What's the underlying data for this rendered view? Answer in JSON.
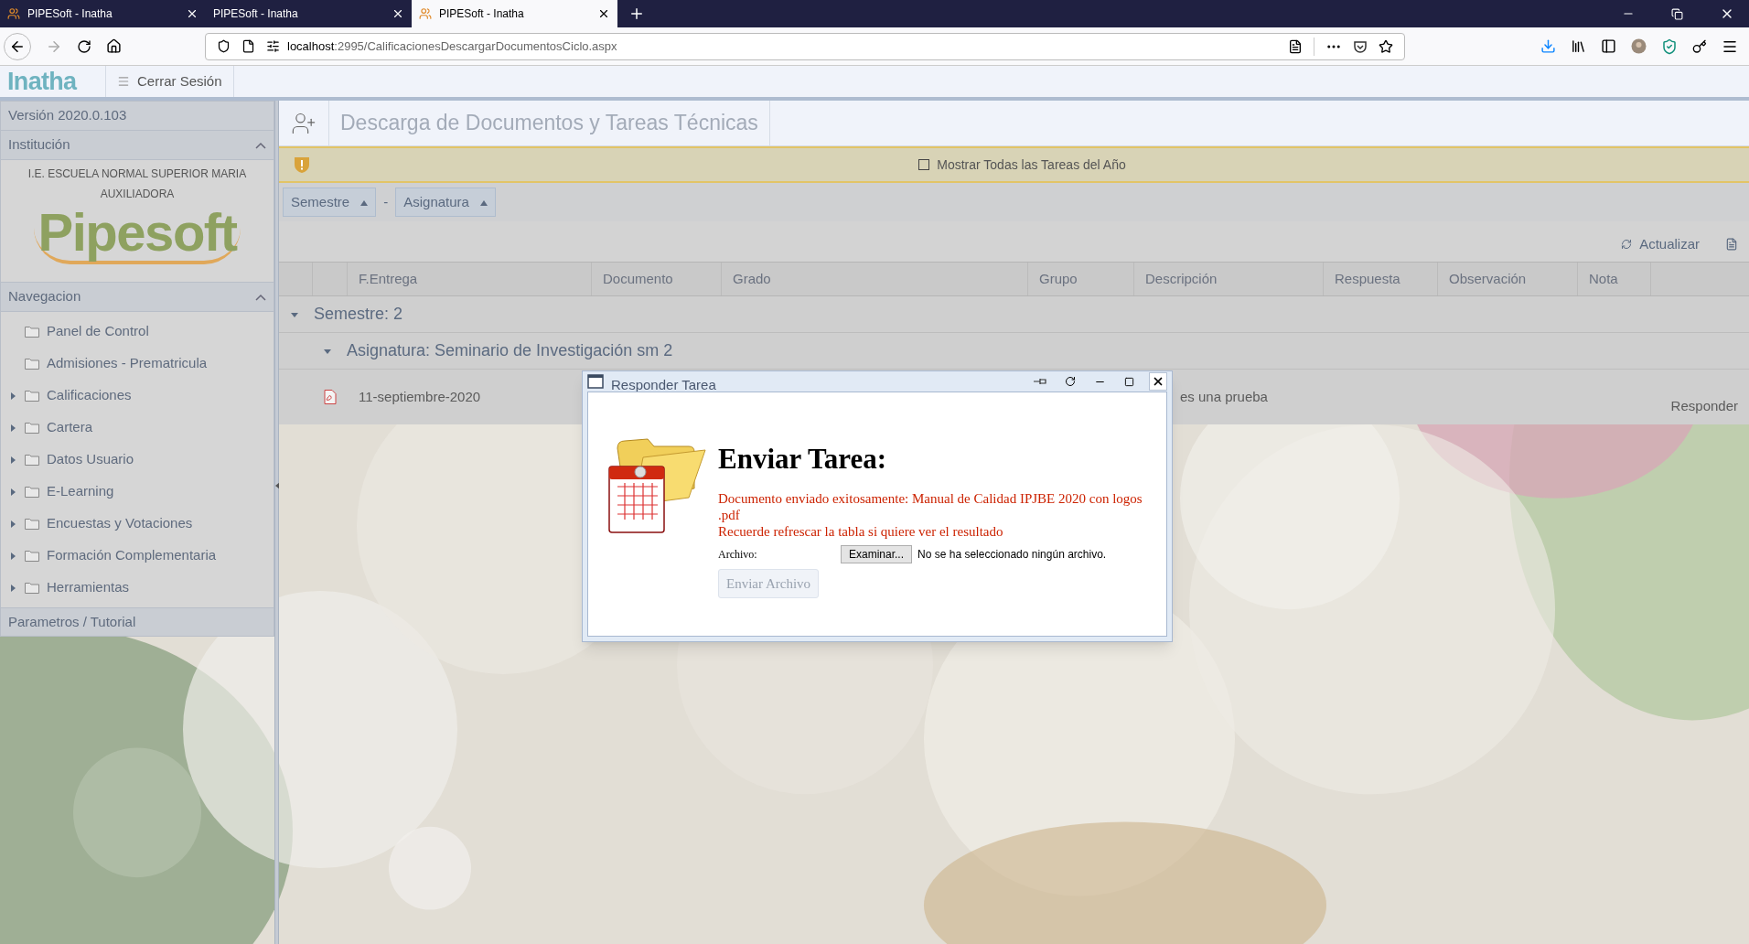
{
  "browser": {
    "tabs": [
      {
        "title": "PIPESoft - Inatha",
        "selected": false,
        "has_icon": true
      },
      {
        "title": "PIPESoft - Inatha",
        "selected": false,
        "has_icon": false
      },
      {
        "title": "PIPESoft - Inatha",
        "selected": true,
        "has_icon": true
      }
    ],
    "url": {
      "host": "localhost",
      "path": ":2995/CalificacionesDescargarDocumentosCiclo.aspx"
    }
  },
  "app_header": {
    "logo": "Inatha",
    "logout": "Cerrar Sesión"
  },
  "sidebar": {
    "version": "Versión 2020.0.103",
    "institution": {
      "title": "Institución",
      "expanded": true,
      "name": "I.E. ESCUELA NORMAL SUPERIOR MARIA AUXILIADORA",
      "logo": "Pipesoft"
    },
    "navigation": {
      "title": "Navegacion",
      "expanded": true,
      "items": [
        {
          "label": "Panel de Control",
          "has_children": false
        },
        {
          "label": "Admisiones - Prematricula",
          "has_children": false
        },
        {
          "label": "Calificaciones",
          "has_children": true
        },
        {
          "label": "Cartera",
          "has_children": true
        },
        {
          "label": "Datos Usuario",
          "has_children": true
        },
        {
          "label": "E-Learning",
          "has_children": true
        },
        {
          "label": "Encuestas y Votaciones",
          "has_children": true
        },
        {
          "label": "Formación Complementaria",
          "has_children": true
        },
        {
          "label": "Herramientas",
          "has_children": true
        }
      ]
    },
    "footer": "Parametros / Tutorial"
  },
  "main": {
    "title": "Descarga de Documentos y Tareas Técnicas",
    "notice": {
      "label": "Mostrar Todas las Tareas del Año",
      "checked": false
    },
    "group_chips": [
      "Semestre",
      "Asignatura"
    ],
    "chip_separator": "-",
    "refresh": "Actualizar",
    "columns": [
      "F.Entrega",
      "Documento",
      "Grado",
      "Grupo",
      "Descripción",
      "Respuesta",
      "Observación",
      "Nota"
    ],
    "groups": [
      {
        "label": "Semestre: 2",
        "expanded": true,
        "subgroups": [
          {
            "label": "Asignatura: Seminario de Investigación sm 2",
            "expanded": true,
            "rows": [
              {
                "date": "11-septiembre-2020",
                "description": "es una prueba",
                "action": "Responder"
              }
            ]
          }
        ]
      }
    ]
  },
  "dialog": {
    "title": "Responder Tarea",
    "heading": "Enviar Tarea:",
    "messages": [
      "Documento enviado exitosamente: Manual de Calidad IPJBE 2020 con logos .pdf",
      "Recuerde refrescar la tabla si quiere ver el resultado"
    ],
    "file_label": "Archivo:",
    "browse_button": "Examinar...",
    "file_status": "No se ha seleccionado ningún archivo.",
    "submit": {
      "label": "Enviar Archivo",
      "disabled": true
    }
  }
}
